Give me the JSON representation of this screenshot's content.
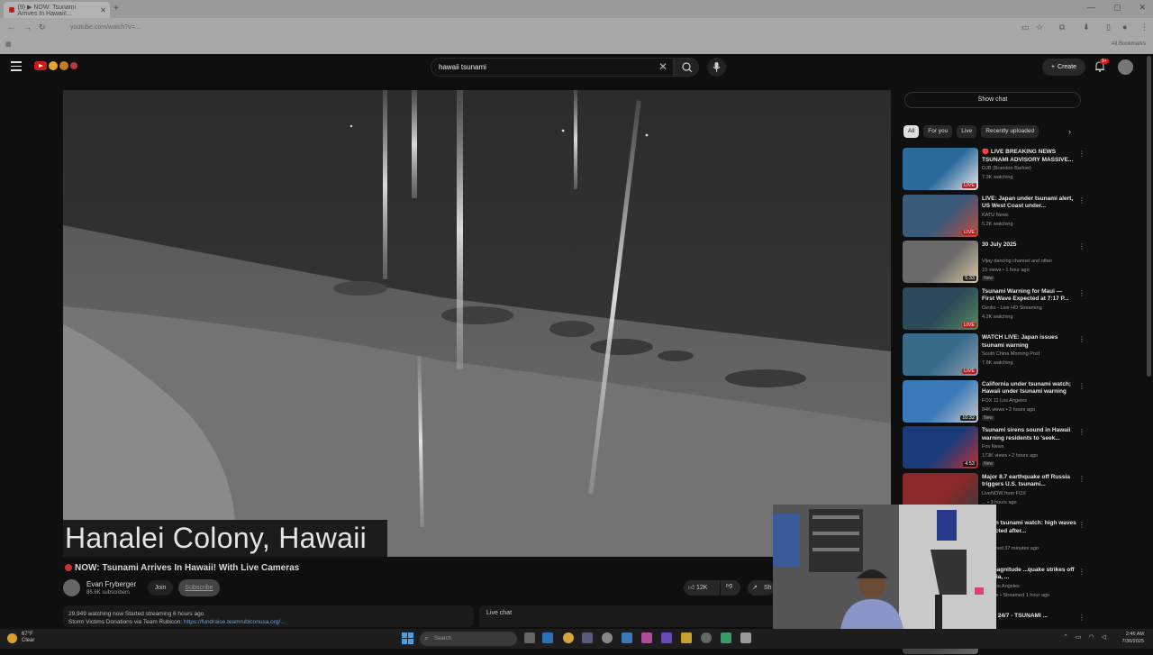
{
  "browser": {
    "tab_title": "(9) ▶ NOW: Tsunami Arrives In Hawaii!...",
    "url": "youtube.com/watch?v=...",
    "bookmarks_label": "All Bookmarks"
  },
  "header": {
    "search_value": "hawaii tsunami",
    "create_label": "Create",
    "notification_count": "9+"
  },
  "video": {
    "caption": "Hanalei Colony, Hawaii",
    "title": "NOW: Tsunami Arrives In Hawaii! With Live Cameras",
    "channel_name": "Evan Fryberger",
    "subscribers": "86.6K subscribers",
    "join_label": "Join",
    "subscribe_label": "Subscribe",
    "likes": "12K",
    "share_label": "Sh",
    "description_line1": "29,949 watching now  Started streaming 6 hours ago",
    "description_line2_prefix": "Storm Victims Donations via Team Rubicon: ",
    "description_link": "https://fundraise.teamrubiconusa.org/...",
    "live_chat_label": "Live chat"
  },
  "sidebar": {
    "show_chat": "Show chat",
    "chips": [
      "All",
      "For you",
      "Live",
      "Recently uploaded"
    ],
    "recommendations": [
      {
        "title": "🔴 LIVE BREAKING NEWS TSUNAMI ADVISORY MASSIVE...",
        "channel": "DJB (Brandon Barlow)",
        "meta": "7.3K watching",
        "badge": "LIVE",
        "live": true,
        "new": ""
      },
      {
        "title": "LIVE: Japan under tsunami alert, US West Coast under...",
        "channel": "KATU News",
        "meta": "5.2K watching",
        "badge": "LIVE",
        "live": true,
        "new": ""
      },
      {
        "title": "30 July 2025",
        "channel": "Vijay dancing channel and other",
        "meta": "10 views • 1 hour ago",
        "badge": "5:33",
        "live": false,
        "new": "New"
      },
      {
        "title": "Tsunami Warning for Maui — First Wave Expected at 7:17 P...",
        "channel": "Ozolio - Live HD Streaming",
        "meta": "4.2K watching",
        "badge": "LIVE",
        "live": true,
        "new": ""
      },
      {
        "title": "WATCH LIVE: Japan issues tsunami warning",
        "channel": "South China Morning Post",
        "meta": "7.8K watching",
        "badge": "LIVE",
        "live": true,
        "new": ""
      },
      {
        "title": "California under tsunami watch; Hawaii under tsunami warning",
        "channel": "FOX 11 Los Angeles",
        "meta": "84K views • 2 hours ago",
        "badge": "10:32",
        "live": false,
        "new": "New"
      },
      {
        "title": "Tsunami sirens sound in Hawaii warning residents to 'seek...",
        "channel": "Fox News",
        "meta": "173K views • 2 hours ago",
        "badge": "4:53",
        "live": false,
        "new": "New"
      },
      {
        "title": "Major 8.7 earthquake off Russia triggers U.S. tsunami...",
        "channel": "LiveNOW from FOX",
        "meta": "... • 3 hours ago",
        "badge": "",
        "live": false,
        "new": ""
      },
      {
        "title": "Japan tsunami watch: high waves expected after...",
        "channel": "",
        "meta": "Streamed 37 minutes ago",
        "badge": "",
        "live": false,
        "new": ""
      },
      {
        "title": "8.8 magnitude ...quake strikes off Russia, ...",
        "channel": "...11 Los Angeles",
        "meta": "...views • Streamed 1 hour ago",
        "badge": "",
        "live": false,
        "new": ""
      },
      {
        "title": "...WS 24/7 - TSUNAMI ...",
        "channel": "",
        "meta": "",
        "badge": "",
        "live": false,
        "new": ""
      }
    ]
  },
  "taskbar": {
    "weather_temp": "67°F",
    "weather_desc": "Clear",
    "search_placeholder": "Search",
    "time": "2:46 AM",
    "date": "7/30/2025"
  }
}
